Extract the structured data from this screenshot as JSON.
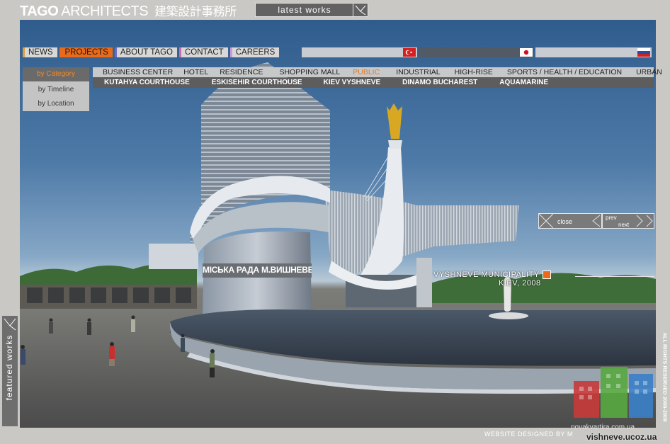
{
  "header": {
    "brand_bold": "TAGO",
    "brand_rest": "ARCHITECTS",
    "brand_cjk": "建築設計事務所",
    "latest_works": "latest works"
  },
  "nav": {
    "items": [
      {
        "label": "NEWS"
      },
      {
        "label": "PROJECTS",
        "active": true
      },
      {
        "label": "ABOUT TAGO"
      },
      {
        "label": "CONTACT"
      },
      {
        "label": "CAREERS"
      }
    ],
    "languages": [
      "turkish-flag-icon",
      "japanese-flag-icon",
      "russian-flag-icon"
    ]
  },
  "filters": {
    "items": [
      {
        "label": "by Category",
        "active": true
      },
      {
        "label": "by Timeline"
      },
      {
        "label": "by Location"
      }
    ]
  },
  "categories": [
    "BUSINESS CENTER",
    "HOTEL",
    "RESIDENCE",
    "SHOPPING MALL",
    "PUBLIC",
    "INDUSTRIAL",
    "HIGH-RISE",
    "SPORTS / HEALTH / EDUCATION",
    "URBAN"
  ],
  "active_category": "PUBLIC",
  "projects": [
    "KUTAHYA COURTHOUSE",
    "ESKISEHIR COURTHOUSE",
    "KIEV VYSHNEVE",
    "DINAMO BUCHAREST",
    "AQUAMARINE"
  ],
  "controls": {
    "close": "close",
    "prev": "prev",
    "next": "next"
  },
  "caption": {
    "title": "VYSHNEVE MUNICIPALITY",
    "subtitle": "KIEV, 2008"
  },
  "building_sign": "МІСЬКА РАДА М.ВИШНЕВЕ",
  "side": {
    "featured": "featured works",
    "rights": "ALL RIGHTS RESERVED 2008-2009"
  },
  "footer": {
    "credit": "WEBSITE DESIGNED BY M",
    "sub_watermark": "novakvartira.com.ua",
    "watermark": "vishneve.ucoz.ua"
  },
  "colors": {
    "accent": "#e86a1a",
    "panel": "#626262"
  }
}
